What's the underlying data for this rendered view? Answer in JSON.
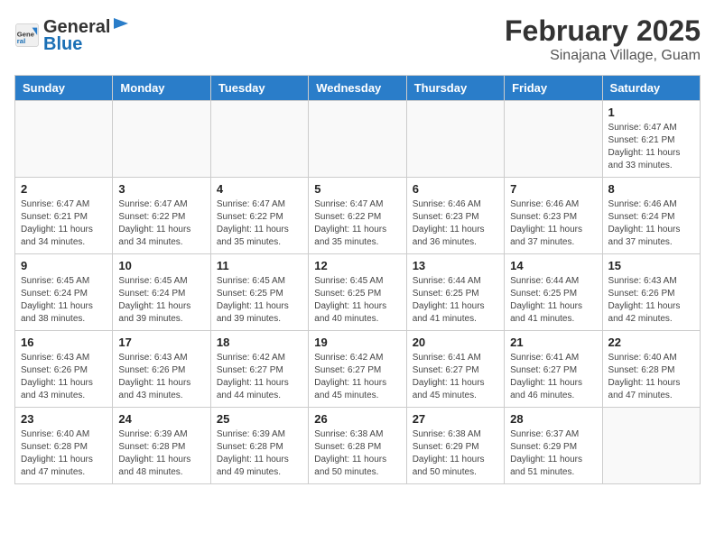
{
  "header": {
    "logo_general": "General",
    "logo_blue": "Blue",
    "month_title": "February 2025",
    "location": "Sinajana Village, Guam"
  },
  "days_of_week": [
    "Sunday",
    "Monday",
    "Tuesday",
    "Wednesday",
    "Thursday",
    "Friday",
    "Saturday"
  ],
  "weeks": [
    [
      {
        "day": "",
        "info": ""
      },
      {
        "day": "",
        "info": ""
      },
      {
        "day": "",
        "info": ""
      },
      {
        "day": "",
        "info": ""
      },
      {
        "day": "",
        "info": ""
      },
      {
        "day": "",
        "info": ""
      },
      {
        "day": "1",
        "info": "Sunrise: 6:47 AM\nSunset: 6:21 PM\nDaylight: 11 hours\nand 33 minutes."
      }
    ],
    [
      {
        "day": "2",
        "info": "Sunrise: 6:47 AM\nSunset: 6:21 PM\nDaylight: 11 hours\nand 34 minutes."
      },
      {
        "day": "3",
        "info": "Sunrise: 6:47 AM\nSunset: 6:22 PM\nDaylight: 11 hours\nand 34 minutes."
      },
      {
        "day": "4",
        "info": "Sunrise: 6:47 AM\nSunset: 6:22 PM\nDaylight: 11 hours\nand 35 minutes."
      },
      {
        "day": "5",
        "info": "Sunrise: 6:47 AM\nSunset: 6:22 PM\nDaylight: 11 hours\nand 35 minutes."
      },
      {
        "day": "6",
        "info": "Sunrise: 6:46 AM\nSunset: 6:23 PM\nDaylight: 11 hours\nand 36 minutes."
      },
      {
        "day": "7",
        "info": "Sunrise: 6:46 AM\nSunset: 6:23 PM\nDaylight: 11 hours\nand 37 minutes."
      },
      {
        "day": "8",
        "info": "Sunrise: 6:46 AM\nSunset: 6:24 PM\nDaylight: 11 hours\nand 37 minutes."
      }
    ],
    [
      {
        "day": "9",
        "info": "Sunrise: 6:45 AM\nSunset: 6:24 PM\nDaylight: 11 hours\nand 38 minutes."
      },
      {
        "day": "10",
        "info": "Sunrise: 6:45 AM\nSunset: 6:24 PM\nDaylight: 11 hours\nand 39 minutes."
      },
      {
        "day": "11",
        "info": "Sunrise: 6:45 AM\nSunset: 6:25 PM\nDaylight: 11 hours\nand 39 minutes."
      },
      {
        "day": "12",
        "info": "Sunrise: 6:45 AM\nSunset: 6:25 PM\nDaylight: 11 hours\nand 40 minutes."
      },
      {
        "day": "13",
        "info": "Sunrise: 6:44 AM\nSunset: 6:25 PM\nDaylight: 11 hours\nand 41 minutes."
      },
      {
        "day": "14",
        "info": "Sunrise: 6:44 AM\nSunset: 6:25 PM\nDaylight: 11 hours\nand 41 minutes."
      },
      {
        "day": "15",
        "info": "Sunrise: 6:43 AM\nSunset: 6:26 PM\nDaylight: 11 hours\nand 42 minutes."
      }
    ],
    [
      {
        "day": "16",
        "info": "Sunrise: 6:43 AM\nSunset: 6:26 PM\nDaylight: 11 hours\nand 43 minutes."
      },
      {
        "day": "17",
        "info": "Sunrise: 6:43 AM\nSunset: 6:26 PM\nDaylight: 11 hours\nand 43 minutes."
      },
      {
        "day": "18",
        "info": "Sunrise: 6:42 AM\nSunset: 6:27 PM\nDaylight: 11 hours\nand 44 minutes."
      },
      {
        "day": "19",
        "info": "Sunrise: 6:42 AM\nSunset: 6:27 PM\nDaylight: 11 hours\nand 45 minutes."
      },
      {
        "day": "20",
        "info": "Sunrise: 6:41 AM\nSunset: 6:27 PM\nDaylight: 11 hours\nand 45 minutes."
      },
      {
        "day": "21",
        "info": "Sunrise: 6:41 AM\nSunset: 6:27 PM\nDaylight: 11 hours\nand 46 minutes."
      },
      {
        "day": "22",
        "info": "Sunrise: 6:40 AM\nSunset: 6:28 PM\nDaylight: 11 hours\nand 47 minutes."
      }
    ],
    [
      {
        "day": "23",
        "info": "Sunrise: 6:40 AM\nSunset: 6:28 PM\nDaylight: 11 hours\nand 47 minutes."
      },
      {
        "day": "24",
        "info": "Sunrise: 6:39 AM\nSunset: 6:28 PM\nDaylight: 11 hours\nand 48 minutes."
      },
      {
        "day": "25",
        "info": "Sunrise: 6:39 AM\nSunset: 6:28 PM\nDaylight: 11 hours\nand 49 minutes."
      },
      {
        "day": "26",
        "info": "Sunrise: 6:38 AM\nSunset: 6:28 PM\nDaylight: 11 hours\nand 50 minutes."
      },
      {
        "day": "27",
        "info": "Sunrise: 6:38 AM\nSunset: 6:29 PM\nDaylight: 11 hours\nand 50 minutes."
      },
      {
        "day": "28",
        "info": "Sunrise: 6:37 AM\nSunset: 6:29 PM\nDaylight: 11 hours\nand 51 minutes."
      },
      {
        "day": "",
        "info": ""
      }
    ]
  ]
}
